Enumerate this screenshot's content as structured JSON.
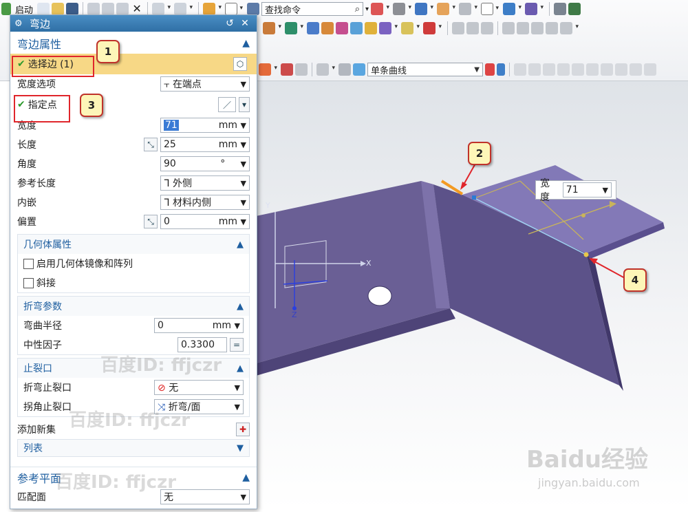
{
  "toolbar": {
    "start_label": "启动",
    "search_placeholder": "查找命令",
    "curve_filter": "单条曲线"
  },
  "dialog": {
    "title": "弯边",
    "flange_section": "弯边属性",
    "select_edge": "选择边 (1)",
    "width_option_label": "宽度选项",
    "width_option_value": "在端点",
    "specify_point": "指定点",
    "width_label": "宽度",
    "width_value": "71",
    "width_unit": "mm",
    "length_label": "长度",
    "length_value": "25",
    "length_unit": "mm",
    "angle_label": "角度",
    "angle_value": "90",
    "angle_unit": "°",
    "ref_length_label": "参考长度",
    "ref_length_value": "外侧",
    "inset_label": "内嵌",
    "inset_value": "材料内侧",
    "offset_label": "偏置",
    "offset_value": "0",
    "offset_unit": "mm",
    "geom_section": "几何体属性",
    "mirror_pattern": "启用几何体镜像和阵列",
    "chamfer": "斜接",
    "bend_section": "折弯参数",
    "bend_radius_label": "弯曲半径",
    "bend_radius_value": "0",
    "bend_radius_unit": "mm",
    "neutral_label": "中性因子",
    "neutral_value": "0.3300",
    "relief_section": "止裂口",
    "bend_relief_label": "折弯止裂口",
    "bend_relief_value": "无",
    "corner_relief_label": "拐角止裂口",
    "corner_relief_value": "折弯/面",
    "add_set": "添加新集",
    "list_label": "列表",
    "ref_plane_section": "参考平面",
    "match_face_label": "匹配面",
    "match_face_value": "无"
  },
  "viewport": {
    "width_popup_label": "宽度",
    "width_popup_value": "71",
    "axis_x": "X",
    "axis_y": "Y",
    "axis_z": "Z"
  },
  "callouts": [
    "1",
    "2",
    "3",
    "4"
  ],
  "watermarks": {
    "wm1": "百度ID: ffjczr",
    "wm2": "百度ID: ffjczr",
    "wm3": "百度ID: ffjczr",
    "baidu_logo": "Baidu经验",
    "baidu_url": "jingyan.baidu.com"
  },
  "colors": {
    "part_face": "#6a5f95",
    "part_dark": "#4e4478",
    "title_bar": "#2f6fa5",
    "accent_blue": "#1f5fa0",
    "highlight_yellow": "#f7d886",
    "callout_border": "#c0322a"
  }
}
